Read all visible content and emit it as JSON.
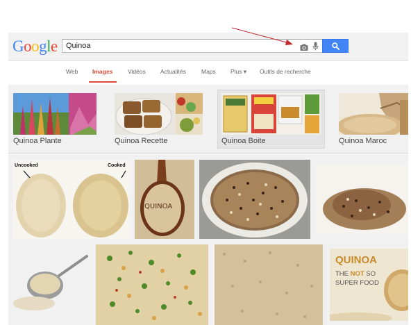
{
  "logo": {
    "letters": [
      "G",
      "o",
      "o",
      "g",
      "l",
      "e"
    ],
    "colors": [
      "#4285f4",
      "#ea4335",
      "#fbbc05",
      "#4285f4",
      "#34a853",
      "#ea4335"
    ]
  },
  "search": {
    "query": "Quinoa",
    "camera_icon": "camera-icon",
    "mic_icon": "mic-icon",
    "submit_icon": "magnifier-icon",
    "button_color": "#4285f4"
  },
  "tabs": {
    "items": [
      {
        "label": "Web"
      },
      {
        "label": "Images"
      },
      {
        "label": "Vidéos"
      },
      {
        "label": "Actualités"
      },
      {
        "label": "Maps"
      },
      {
        "label": "Plus ▾"
      },
      {
        "label": "Outils de recherche"
      }
    ],
    "active_index": 1,
    "active_color": "#dd4b39"
  },
  "related_searches": [
    {
      "label": "Quinoa Plante"
    },
    {
      "label": "Quinoa Recette"
    },
    {
      "label": "Quinoa Boite"
    },
    {
      "label": "Quinoa Maroc"
    }
  ],
  "image_texts": {
    "uncooked": "Uncooked",
    "cooked": "Cooked",
    "spoon": "QUINOA",
    "poster_title": "QUINOA",
    "poster_line1_a": "THE ",
    "poster_line1_b": "NOT",
    "poster_line1_c": " SO",
    "poster_line2": "SUPER FOOD"
  },
  "annotation": {
    "arrow_color": "#c0272d",
    "points_to": "camera-icon"
  }
}
